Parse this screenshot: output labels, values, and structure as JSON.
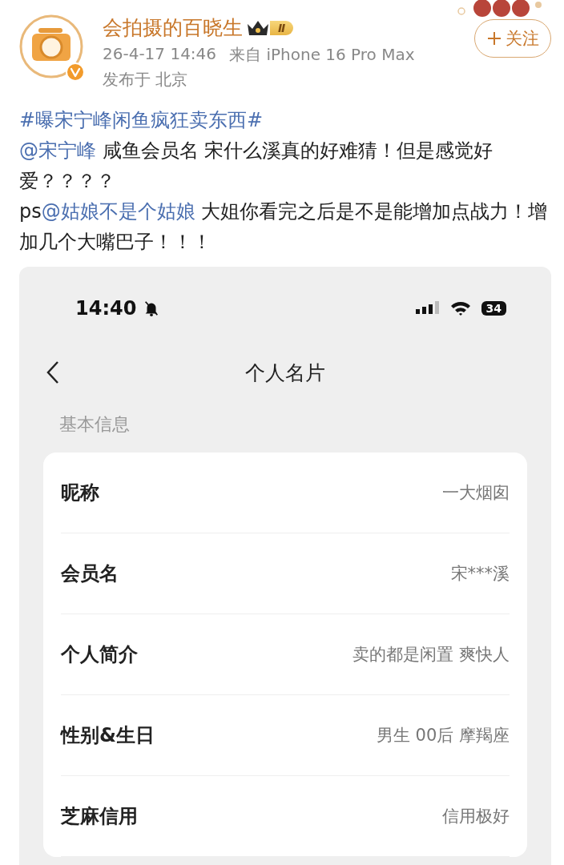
{
  "author": {
    "name": "会拍摄的百晓生",
    "level": "Ⅱ",
    "verified": true,
    "time": "26-4-17 14:46",
    "source": "来自 iPhone 16 Pro Max",
    "location": "发布于 北京"
  },
  "follow_button": {
    "label": "关注"
  },
  "post": {
    "hashtag": "#曝宋宁峰闲鱼疯狂卖东西#",
    "paragraphs": [
      [
        {
          "kind": "mention",
          "text": "@宋宁峰"
        },
        {
          "kind": "text",
          "text": " 咸鱼会员名 宋什么溪真的好难猜！但是感觉好爱？？？？"
        }
      ],
      [
        {
          "kind": "text",
          "text": "ps"
        },
        {
          "kind": "mention",
          "text": "@姑娘不是个姑娘"
        },
        {
          "kind": "text",
          "text": " 大姐你看完之后是不是能增加点战力！增加几个大嘴巴子！！！"
        }
      ]
    ]
  },
  "screenshot": {
    "status_bar": {
      "time": "14:40",
      "battery": "34"
    },
    "nav_title": "个人名片",
    "section_label": "基本信息",
    "rows": [
      {
        "label": "昵称",
        "value": "一大烟囱"
      },
      {
        "label": "会员名",
        "value": "宋***溪"
      },
      {
        "label": "个人简介",
        "value": "卖的都是闲置 爽快人"
      },
      {
        "label": "性别&生日",
        "value": "男生 00后 摩羯座"
      },
      {
        "label": "芝麻信用",
        "value": "信用极好"
      }
    ]
  }
}
